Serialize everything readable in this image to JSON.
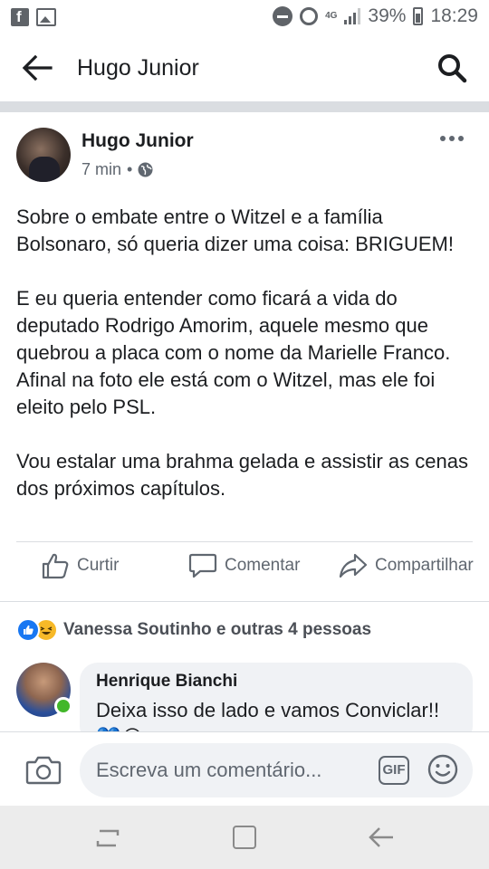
{
  "status_bar": {
    "network": "4G",
    "battery": "39%",
    "time": "18:29",
    "icons": [
      "facebook-icon",
      "gallery-icon",
      "dnd-icon",
      "alarm-icon",
      "signal-icon",
      "battery-icon"
    ]
  },
  "header": {
    "title": "Hugo Junior",
    "back_icon": "arrow-left",
    "search_icon": "search"
  },
  "post": {
    "author": "Hugo Junior",
    "time": "7 min",
    "separator": "•",
    "privacy_icon": "globe",
    "paragraphs": [
      "Sobre o embate entre o Witzel e a família Bolsonaro, só queria dizer uma coisa: BRIGUEM!",
      "E eu queria entender como ficará a vida do deputado Rodrigo Amorim, aquele mesmo que quebrou a placa com o nome da Marielle Franco. Afinal na foto ele está com o Witzel, mas ele foi eleito pelo PSL.",
      "Vou estalar uma brahma gelada e assistir as cenas dos próximos capítulos."
    ],
    "actions": {
      "like": "Curtir",
      "comment": "Comentar",
      "share": "Compartilhar"
    },
    "reactions_text": "Vanessa Soutinho e outras 4 pessoas"
  },
  "comment": {
    "author": "Henrique Bianchi",
    "text": "Deixa isso de lado e vamos Conviclar!! 💙😂"
  },
  "composer": {
    "placeholder": "Escreva um comentário...",
    "gif_label": "GIF"
  },
  "colors": {
    "brand_blue": "#1877f2",
    "text_primary": "#1c1e21",
    "text_secondary": "#606770",
    "divider": "#dadde1",
    "bubble": "#f0f2f5",
    "online": "#42b72a"
  }
}
